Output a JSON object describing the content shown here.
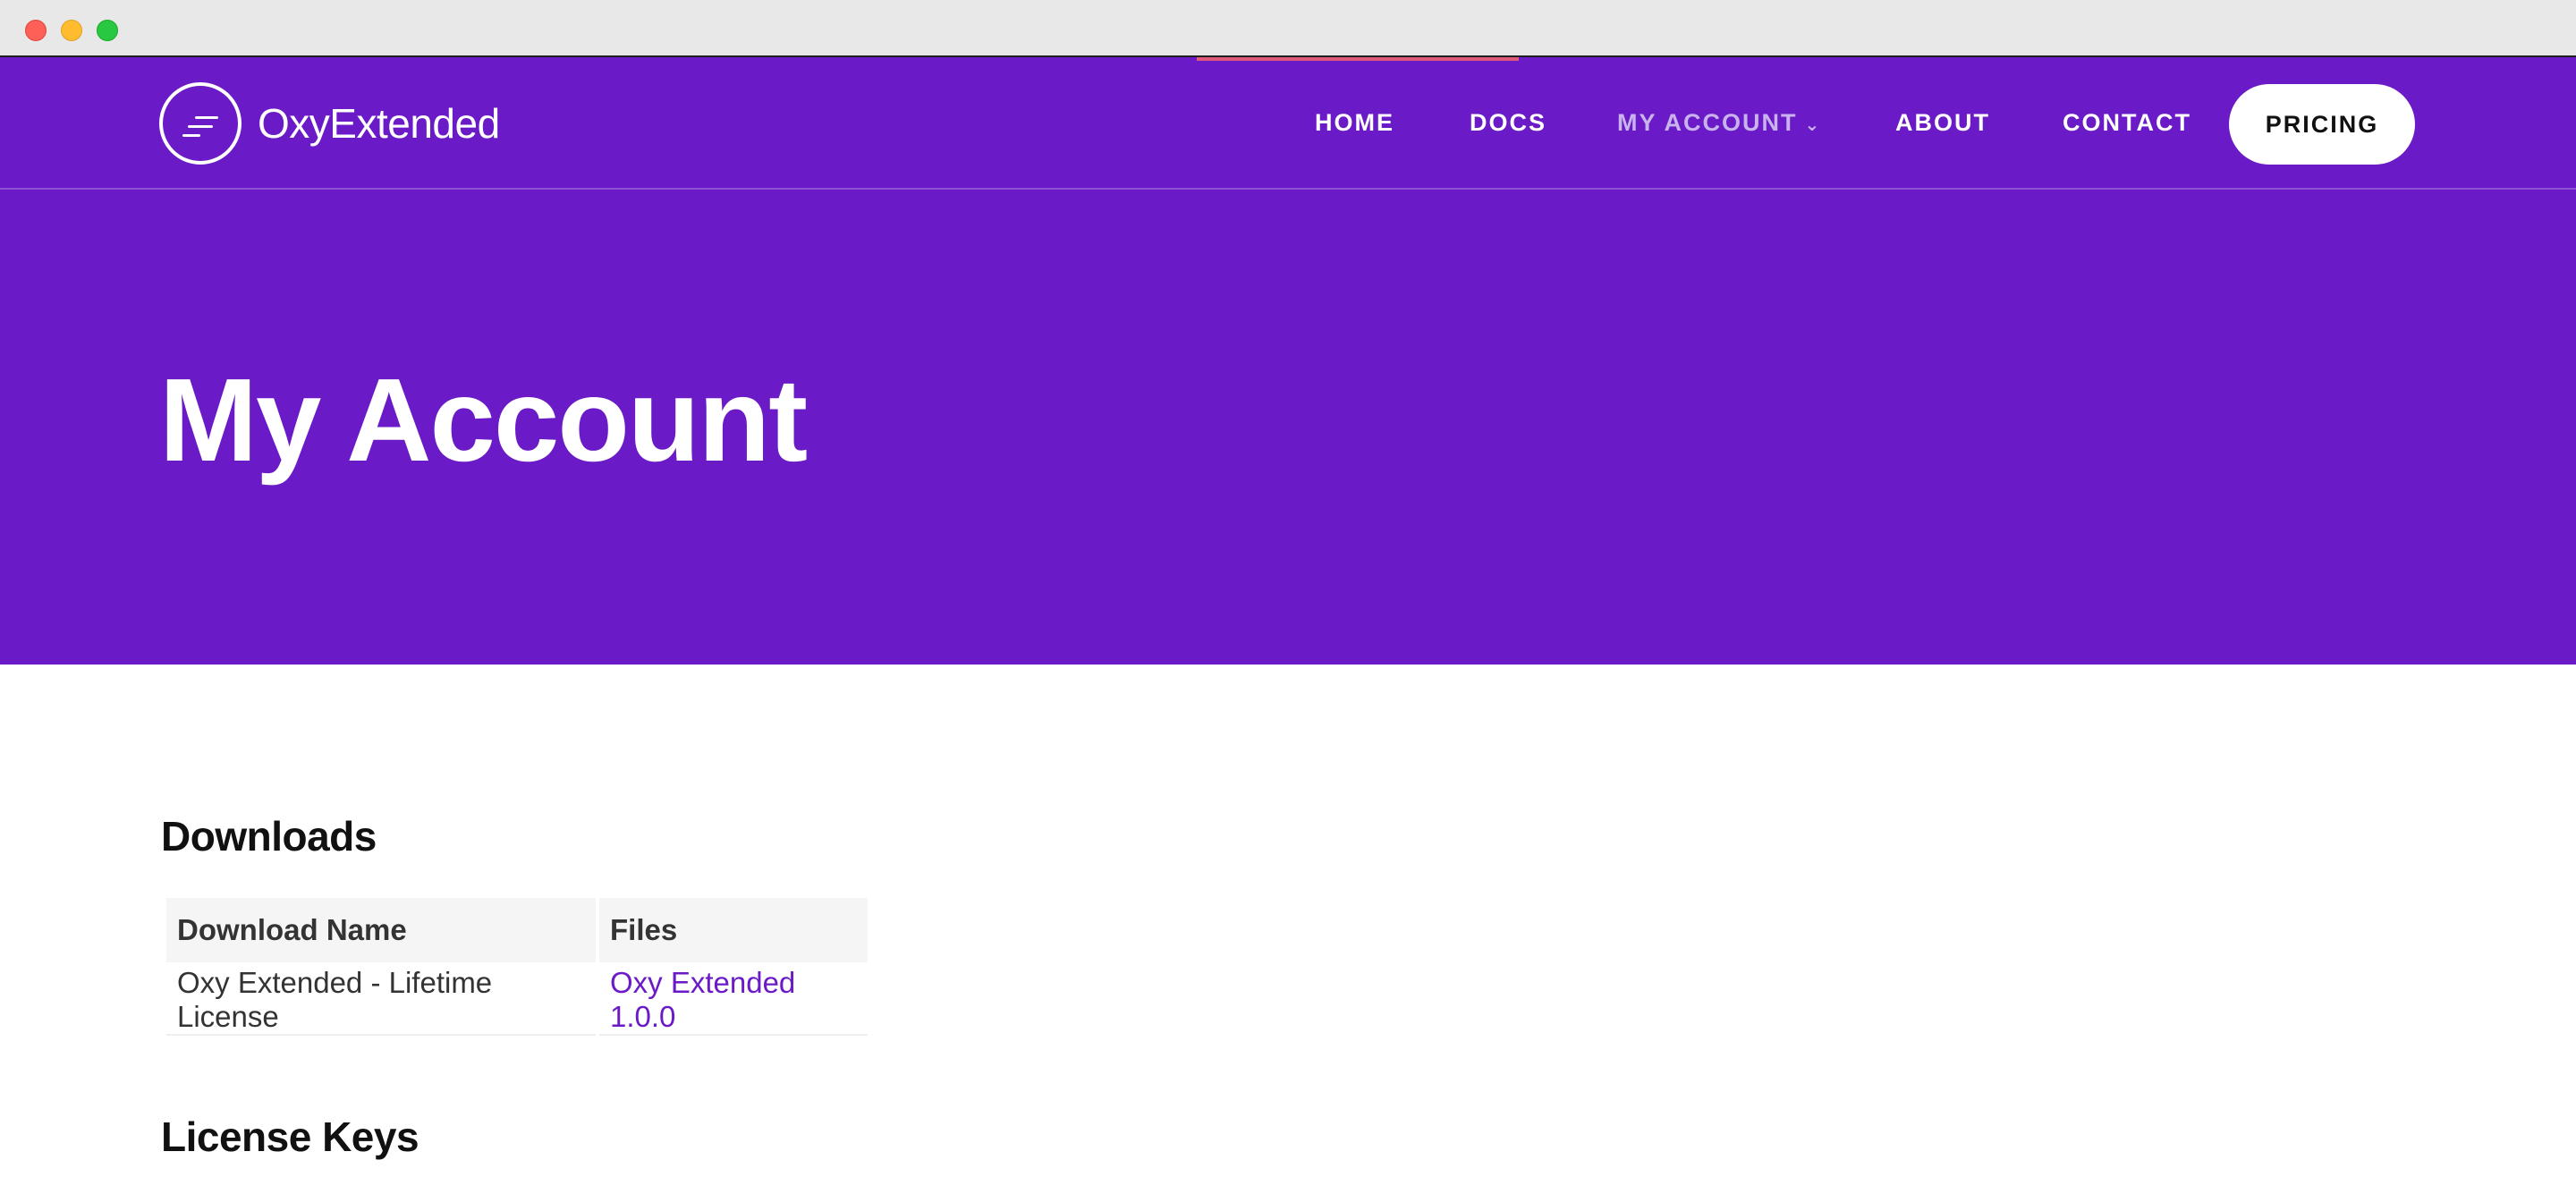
{
  "brand": {
    "name": "OxyExtended",
    "colors": {
      "primary": "#6a1ac6",
      "accent": "#e0587a",
      "link": "#6a1ac6"
    }
  },
  "nav": {
    "items": [
      {
        "label": "HOME"
      },
      {
        "label": "DOCS"
      },
      {
        "label": "MY ACCOUNT",
        "has_dropdown": true,
        "active": true
      },
      {
        "label": "ABOUT"
      },
      {
        "label": "CONTACT"
      }
    ],
    "cta_label": "PRICING"
  },
  "hero": {
    "title": "My Account"
  },
  "downloads": {
    "title": "Downloads",
    "columns": [
      "Download Name",
      "Files"
    ],
    "rows": [
      {
        "name": "Oxy Extended - Lifetime License",
        "file": "Oxy Extended 1.0.0"
      }
    ]
  },
  "license_keys": {
    "title": "License Keys"
  }
}
